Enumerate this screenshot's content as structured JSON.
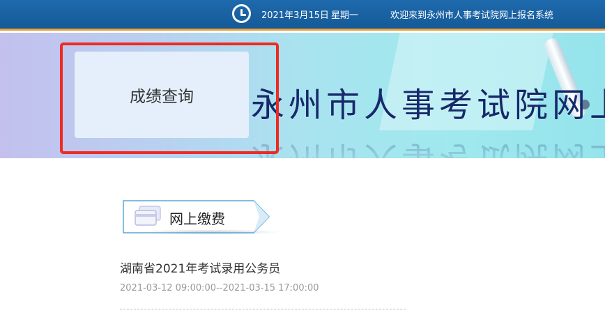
{
  "header": {
    "date": "2021年3月15日",
    "weekday": "星期一",
    "welcome": "欢迎来到永州市人事考试院网上报名系统",
    "clock_icon": "clock-icon"
  },
  "banner": {
    "title": "永州市人事考试院网上",
    "score_query_label": "成绩查询"
  },
  "section": {
    "label": "网上缴费",
    "icon": "payment-card-icon"
  },
  "exam_list": [
    {
      "title": "湖南省2021年考试录用公务员",
      "time": "2021-03-12 09:00:00--2021-03-15 17:00:00"
    }
  ],
  "colors": {
    "topbar": "#1e6aad",
    "topbar_border": "#e9a23a",
    "banner_title": "#16296b",
    "highlight": "#ee2b22",
    "button_bg": "#e4effb"
  }
}
